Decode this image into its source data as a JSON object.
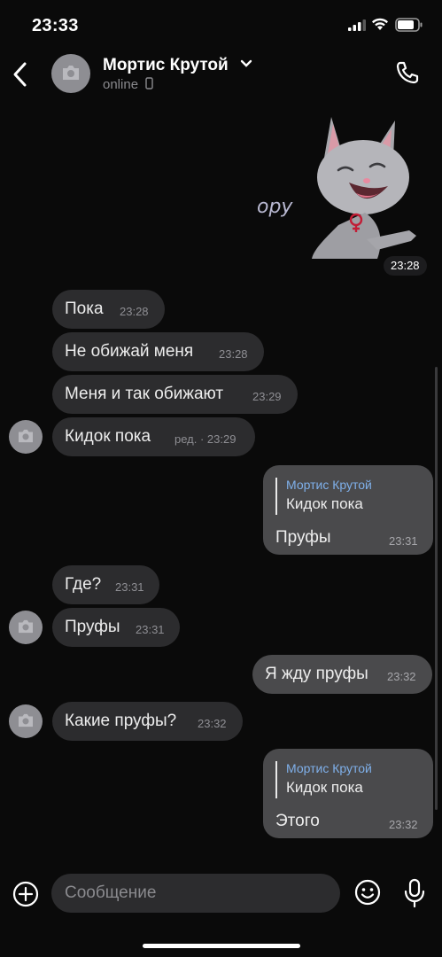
{
  "status_bar": {
    "time": "23:33"
  },
  "header": {
    "contact_name": "Мортис Крутой",
    "status": "online"
  },
  "sticker": {
    "caption": "ору",
    "time": "23:28"
  },
  "messages": [
    {
      "text": "Пока",
      "time": "23:28",
      "direction": "in"
    },
    {
      "text": "Не обижай меня",
      "time": "23:28",
      "direction": "in"
    },
    {
      "text": "Меня и так обижают",
      "time": "23:29",
      "direction": "in"
    },
    {
      "text": "Кидок пока",
      "time": "ред. · 23:29",
      "direction": "in"
    },
    {
      "reply_to_name": "Мортис Крутой",
      "reply_to_text": "Кидок пока",
      "text": "Пруфы",
      "time": "23:31",
      "direction": "out"
    },
    {
      "text": "Где?",
      "time": "23:31",
      "direction": "in"
    },
    {
      "text": "Пруфы",
      "time": "23:31",
      "direction": "in"
    },
    {
      "text": "Я жду пруфы",
      "time": "23:32",
      "direction": "out"
    },
    {
      "text": "Какие пруфы?",
      "time": "23:32",
      "direction": "in"
    },
    {
      "reply_to_name": "Мортис Крутой",
      "reply_to_text": "Кидок пока",
      "text": "Этого",
      "time": "23:32",
      "direction": "out"
    }
  ],
  "composer": {
    "placeholder": "Сообщение"
  },
  "colors": {
    "background": "#0a0a0a",
    "incoming_bubble": "#2c2c2e",
    "outgoing_bubble": "#4a4a4c",
    "reply_name": "#7fb0ea"
  }
}
